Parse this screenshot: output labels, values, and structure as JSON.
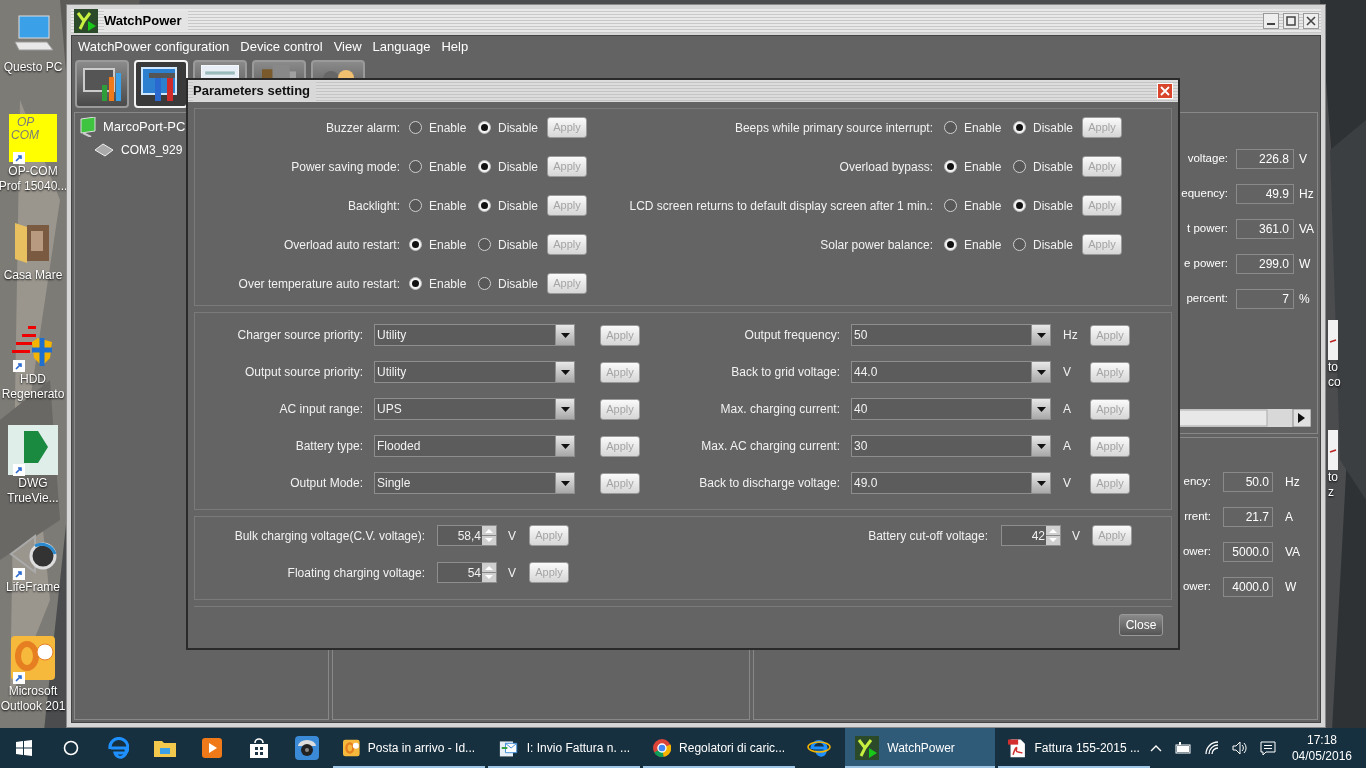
{
  "desktop": {
    "icons": [
      {
        "kind": "pc",
        "lines": [
          "Questo PC"
        ]
      },
      {
        "kind": "opcom",
        "badge": [
          "OP",
          "COM"
        ],
        "lines": [
          "OP-COM",
          "Prof 15040..."
        ]
      },
      {
        "kind": "folder",
        "lines": [
          "Casa Mare"
        ]
      },
      {
        "kind": "hdd",
        "lines": [
          "HDD",
          "Regenerato"
        ]
      },
      {
        "kind": "dwg",
        "lines": [
          "DWG",
          "TrueVie..."
        ]
      },
      {
        "kind": "lifeframe",
        "lines": [
          "LifeFrame"
        ]
      },
      {
        "kind": "outlook",
        "lines": [
          "Microsoft",
          "Outlook 201"
        ]
      }
    ],
    "right_icons": [
      {
        "lines": [
          "to",
          "co"
        ]
      },
      {
        "lines": [
          "to",
          "z"
        ]
      }
    ]
  },
  "window": {
    "title": "WatchPower",
    "menu": [
      "WatchPower configuration",
      "Device control",
      "View",
      "Language",
      "Help"
    ],
    "toolbar": [
      {
        "kind": "monitor",
        "selected": false
      },
      {
        "kind": "tools",
        "selected": true
      },
      {
        "kind": "window",
        "selected": false
      },
      {
        "kind": "books",
        "selected": false
      },
      {
        "kind": "people",
        "selected": false
      }
    ],
    "tree": {
      "label": "MarcoPort-PC",
      "children": [
        {
          "label": "COM3_929"
        }
      ]
    },
    "readings_top": [
      {
        "label": "voltage:",
        "value": "226.8",
        "unit": "V"
      },
      {
        "label": "equency:",
        "value": "49.9",
        "unit": "Hz"
      },
      {
        "label": "t power:",
        "value": "361.0",
        "unit": "VA"
      },
      {
        "label": "e power:",
        "value": "299.0",
        "unit": "W"
      },
      {
        "label": "percent:",
        "value": "7",
        "unit": "%"
      }
    ],
    "readings_bottom": [
      {
        "label": "ency:",
        "value": "50.0",
        "unit": "Hz"
      },
      {
        "label": "rrent:",
        "value": "21.7",
        "unit": "A"
      },
      {
        "label": "ower:",
        "value": "5000.0",
        "unit": "VA"
      },
      {
        "label": "ower:",
        "value": "4000.0",
        "unit": "W"
      }
    ]
  },
  "dialog": {
    "title": "Parameters setting",
    "toggles_left": [
      {
        "label": "Buzzer alarm:",
        "options": [
          {
            "label": "Enable",
            "selected": false
          },
          {
            "label": "Disable",
            "selected": true
          }
        ],
        "button": "Apply"
      },
      {
        "label": "Power saving mode:",
        "options": [
          {
            "label": "Enable",
            "selected": false
          },
          {
            "label": "Disable",
            "selected": true
          }
        ],
        "button": "Apply"
      },
      {
        "label": "Backlight:",
        "options": [
          {
            "label": "Enable",
            "selected": false
          },
          {
            "label": "Disable",
            "selected": true
          }
        ],
        "button": "Apply"
      },
      {
        "label": "Overload auto restart:",
        "options": [
          {
            "label": "Enable",
            "selected": true
          },
          {
            "label": "Disable",
            "selected": false
          }
        ],
        "button": "Apply"
      },
      {
        "label": "Over temperature auto restart:",
        "options": [
          {
            "label": "Enable",
            "selected": true
          },
          {
            "label": "Disable",
            "selected": false
          }
        ],
        "button": "Apply"
      }
    ],
    "toggles_right": [
      {
        "label": "Beeps while primary source interrupt:",
        "options": [
          {
            "label": "Enable",
            "selected": false
          },
          {
            "label": "Disable",
            "selected": true
          }
        ],
        "button": "Apply"
      },
      {
        "label": "Overload bypass:",
        "options": [
          {
            "label": "Enable",
            "selected": true
          },
          {
            "label": "Disable",
            "selected": false
          }
        ],
        "button": "Apply"
      },
      {
        "label": "LCD screen returns to default display screen after 1 min.:",
        "options": [
          {
            "label": "Enable",
            "selected": false
          },
          {
            "label": "Disable",
            "selected": true
          }
        ],
        "button": "Apply"
      },
      {
        "label": "Solar power balance:",
        "options": [
          {
            "label": "Enable",
            "selected": true
          },
          {
            "label": "Disable",
            "selected": false
          }
        ],
        "button": "Apply"
      }
    ],
    "dropdowns_left": [
      {
        "label": "Charger source priority:",
        "value": "Utility",
        "button": "Apply"
      },
      {
        "label": "Output source priority:",
        "value": "Utility",
        "button": "Apply"
      },
      {
        "label": "AC input range:",
        "value": "UPS",
        "button": "Apply"
      },
      {
        "label": "Battery type:",
        "value": "Flooded",
        "button": "Apply"
      },
      {
        "label": "Output Mode:",
        "value": "Single",
        "button": "Apply"
      }
    ],
    "dropdowns_right": [
      {
        "label": "Output frequency:",
        "value": "50",
        "unit": "Hz",
        "button": "Apply"
      },
      {
        "label": "Back to grid voltage:",
        "value": "44.0",
        "unit": "V",
        "button": "Apply"
      },
      {
        "label": "Max. charging current:",
        "value": "40",
        "unit": "A",
        "button": "Apply"
      },
      {
        "label": "Max. AC charging current:",
        "value": "30",
        "unit": "A",
        "button": "Apply"
      },
      {
        "label": "Back to discharge voltage:",
        "value": "49.0",
        "unit": "V",
        "button": "Apply"
      }
    ],
    "spinners_left": [
      {
        "label": "Bulk charging voltage(C.V. voltage):",
        "value": "58,4",
        "unit": "V",
        "button": "Apply"
      },
      {
        "label": "Floating charging voltage:",
        "value": "54",
        "unit": "V",
        "button": "Apply"
      }
    ],
    "spinners_right": [
      {
        "label": "Battery cut-off voltage:",
        "value": "42",
        "unit": "V",
        "button": "Apply"
      }
    ],
    "close_button": "Close"
  },
  "taskbar": {
    "items": [
      {
        "kind": "start",
        "selected": false,
        "running": false
      },
      {
        "kind": "search",
        "selected": false,
        "running": false
      },
      {
        "kind": "edge",
        "selected": false,
        "running": false
      },
      {
        "kind": "folder",
        "selected": false,
        "running": false
      },
      {
        "kind": "media",
        "selected": false,
        "running": false
      },
      {
        "kind": "store",
        "selected": false,
        "running": false
      },
      {
        "kind": "camera",
        "selected": false,
        "running": false
      },
      {
        "kind": "outlook",
        "label": "Posta in arrivo - Id...",
        "selected": false,
        "running": true
      },
      {
        "kind": "mail",
        "label": "I: Invio Fattura n. ...",
        "selected": false,
        "running": true
      },
      {
        "kind": "chrome",
        "label": "Regolatori di caric...",
        "selected": false,
        "running": true
      },
      {
        "kind": "ie",
        "selected": false,
        "running": false
      },
      {
        "kind": "watchpower",
        "label": "WatchPower",
        "selected": true,
        "running": true
      },
      {
        "kind": "pdf",
        "label": "Fattura 155-2015 ...",
        "selected": false,
        "running": true
      }
    ],
    "time": "17:18",
    "date": "04/05/2016"
  }
}
